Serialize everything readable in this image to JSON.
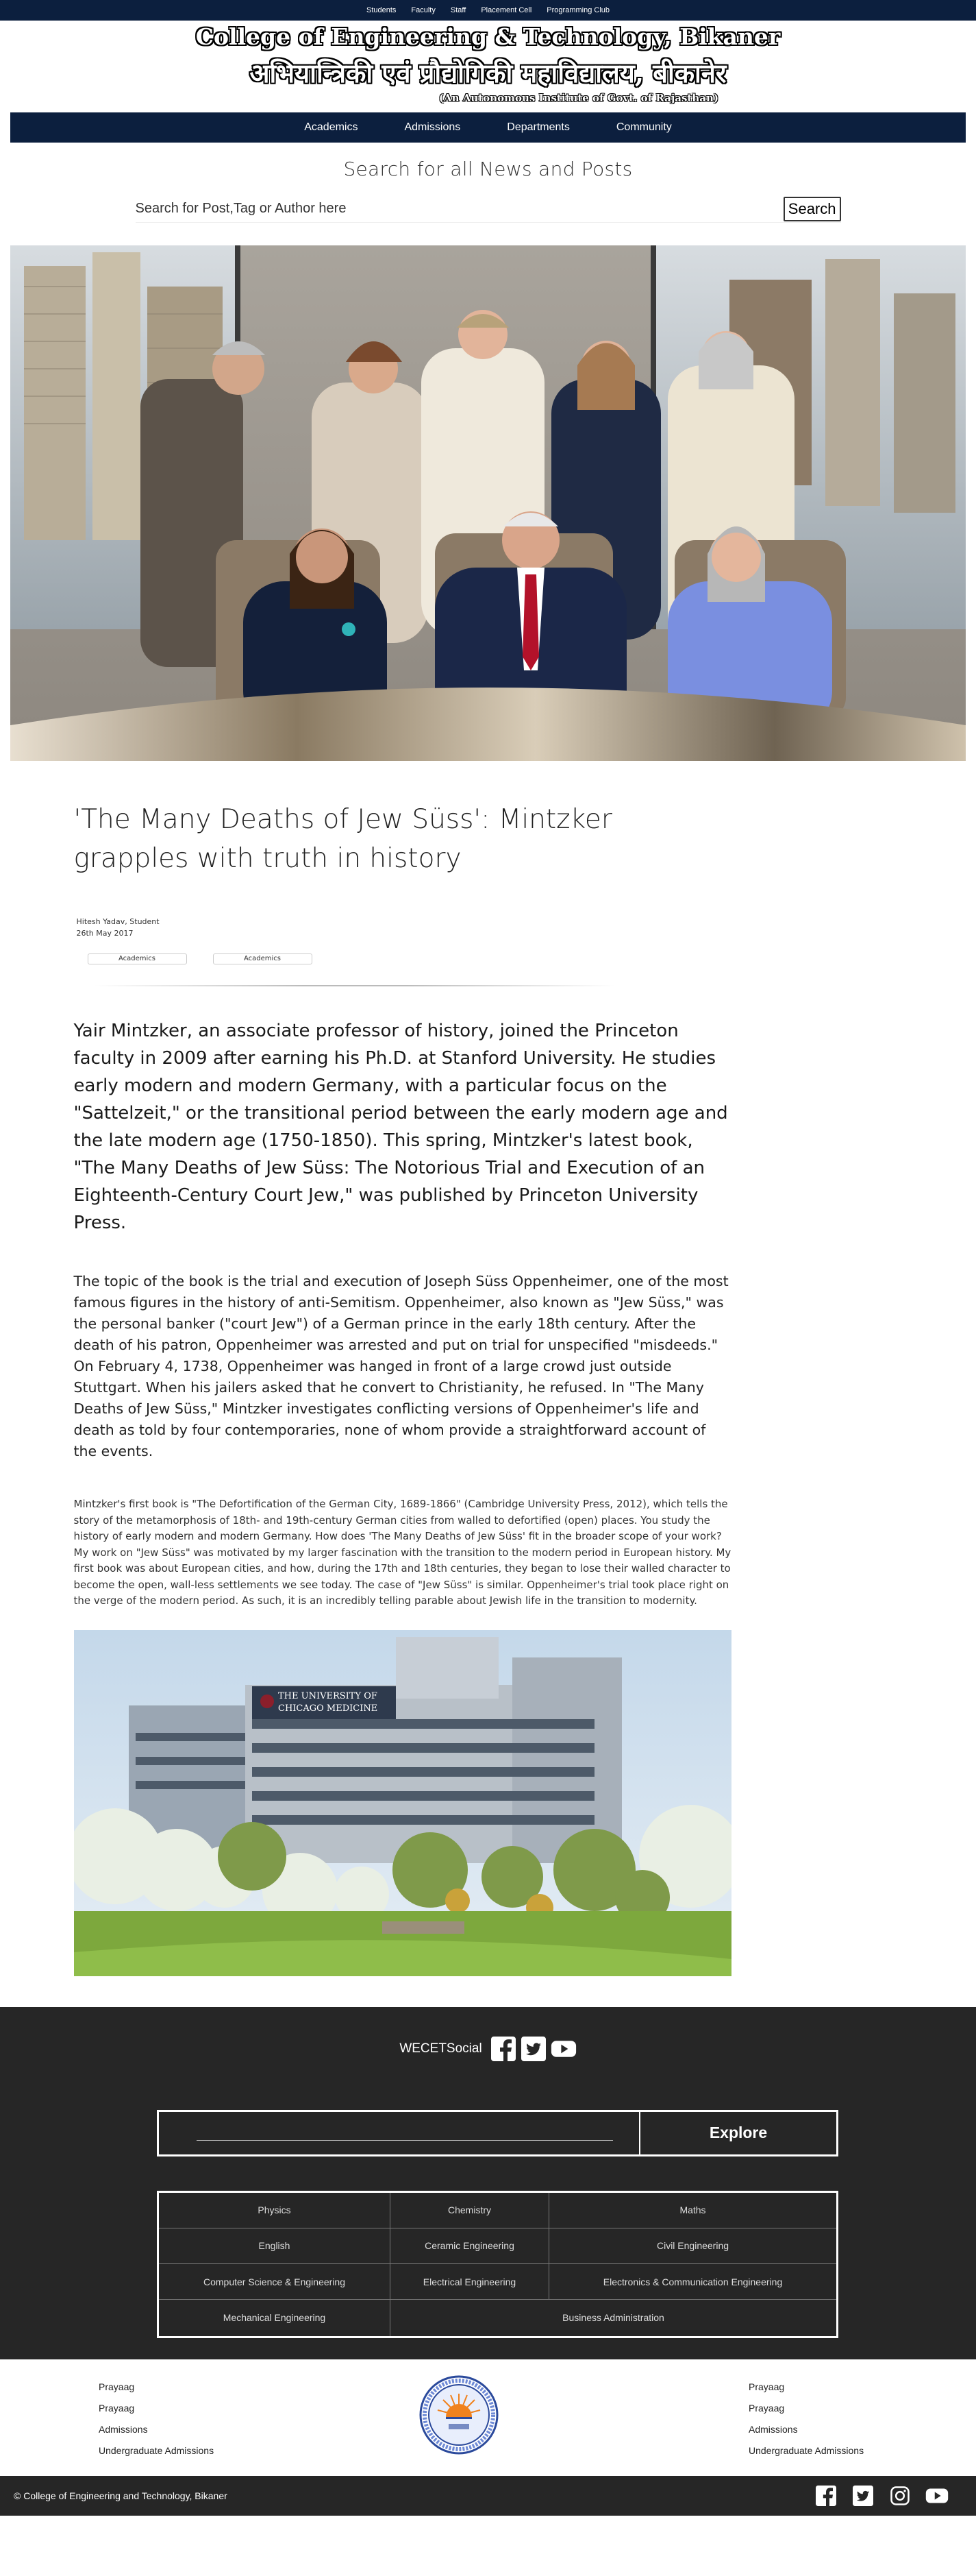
{
  "topbar": {
    "links": [
      "Students",
      "Faculty",
      "Staff",
      "Placement Cell",
      "Programming Club"
    ]
  },
  "masthead": {
    "title_en": "College of Engineering & Technology, Bikaner",
    "title_hi": "अभियान्त्रिकी एवं प्रौद्योगिकी महाविद्यालय, बीकानेर",
    "subtitle": "(An Autonomous Institute of Govt. of Rajasthan)"
  },
  "mainnav": {
    "items": [
      "Academics",
      "Admissions",
      "Departments",
      "Community"
    ]
  },
  "search": {
    "title": "Search for all News and Posts",
    "placeholder": "Search for Post,Tag or Author here",
    "button": "Search"
  },
  "article": {
    "title": "'The Many Deaths of Jew Süss': Mintzker grapples with truth in history",
    "author": "Hitesh Yadav, Student",
    "date": "26th May 2017",
    "tags": [
      "Academics",
      "Academics"
    ],
    "lead": "Yair Mintzker, an associate professor of history, joined the Princeton faculty in 2009 after earning his Ph.D. at Stanford University. He studies early modern and modern Germany, with a particular focus on the \"Sattelzeit,\" or the transitional period between the early modern age and the late modern age (1750-1850). This spring, Mintzker's latest book, \"The Many Deaths of Jew Süss: The Notorious Trial and Execution of an Eighteenth-Century Court Jew,\" was published by Princeton University Press.",
    "para2": "The topic of the book is the trial and execution of Joseph Süss Oppenheimer, one of the most famous figures in the history of anti-Semitism. Oppenheimer, also known as \"Jew Süss,\" was the personal banker (\"court Jew\") of a German prince in the early 18th century. After the death of his patron, Oppenheimer was arrested and put on trial for unspecified \"misdeeds.\" On February 4, 1738, Oppenheimer was hanged in front of a large crowd just outside Stuttgart. When his jailers asked that he convert to Christianity, he refused. In \"The Many Deaths of Jew Süss,\" Mintzker investigates conflicting versions of Oppenheimer's life and death as told by four contemporaries, none of whom provide a straightforward account of the events.",
    "para3": "Mintzker's first book is \"The Defortification of the German City, 1689-1866\" (Cambridge University Press, 2012), which tells the story of the metamorphosis of 18th- and 19th-century German cities from walled to defortified (open) places. You study the history of early modern and modern Germany. How does 'The Many Deaths of Jew Süss' fit in the broader scope of your work? My work on \"Jew Süss\" was motivated by my larger fascination with the transition to the modern period in European history. My first book was about European cities, and how, during the 17th and 18th centuries, they began to lose their walled character to become the open, wall-less settlements we see today. The case of \"Jew Süss\" is similar. Oppenheimer's trial took place right on the verge of the modern period. As such, it is an incredibly telling parable about Jewish life in the transition to modernity.",
    "building_sign_line1": "THE UNIVERSITY OF",
    "building_sign_line2": "CHICAGO MEDICINE"
  },
  "footer": {
    "social_label": "WECETSocial",
    "social_icons": [
      "facebook-icon",
      "twitter-icon",
      "youtube-icon"
    ],
    "explore_button": "Explore",
    "departments": [
      [
        "Physics",
        "Chemistry",
        "Maths"
      ],
      [
        "English",
        "Ceramic Engineering",
        "Civil Engineering"
      ],
      [
        "Computer Science & Engineering",
        "Electrical Engineering",
        "Electronics & Communication Engineering"
      ],
      [
        "Mechanical Engineering",
        "Business Administration"
      ]
    ],
    "links_left": [
      "Prayaag",
      "Prayaag",
      "Admissions",
      "Undergraduate Admissions"
    ],
    "links_right": [
      "Prayaag",
      "Prayaag",
      "Admissions",
      "Undergraduate Admissions"
    ],
    "copyright": "© College of Engineering and Technology, Bikaner",
    "bottom_icons": [
      "facebook-icon",
      "twitter-icon",
      "instagram-icon",
      "youtube-icon"
    ]
  },
  "colors": {
    "navy": "#0c1f3e",
    "footer_dark": "#262626",
    "tie_red": "#b3122a",
    "blazer_blue": "#7a8fe0"
  }
}
